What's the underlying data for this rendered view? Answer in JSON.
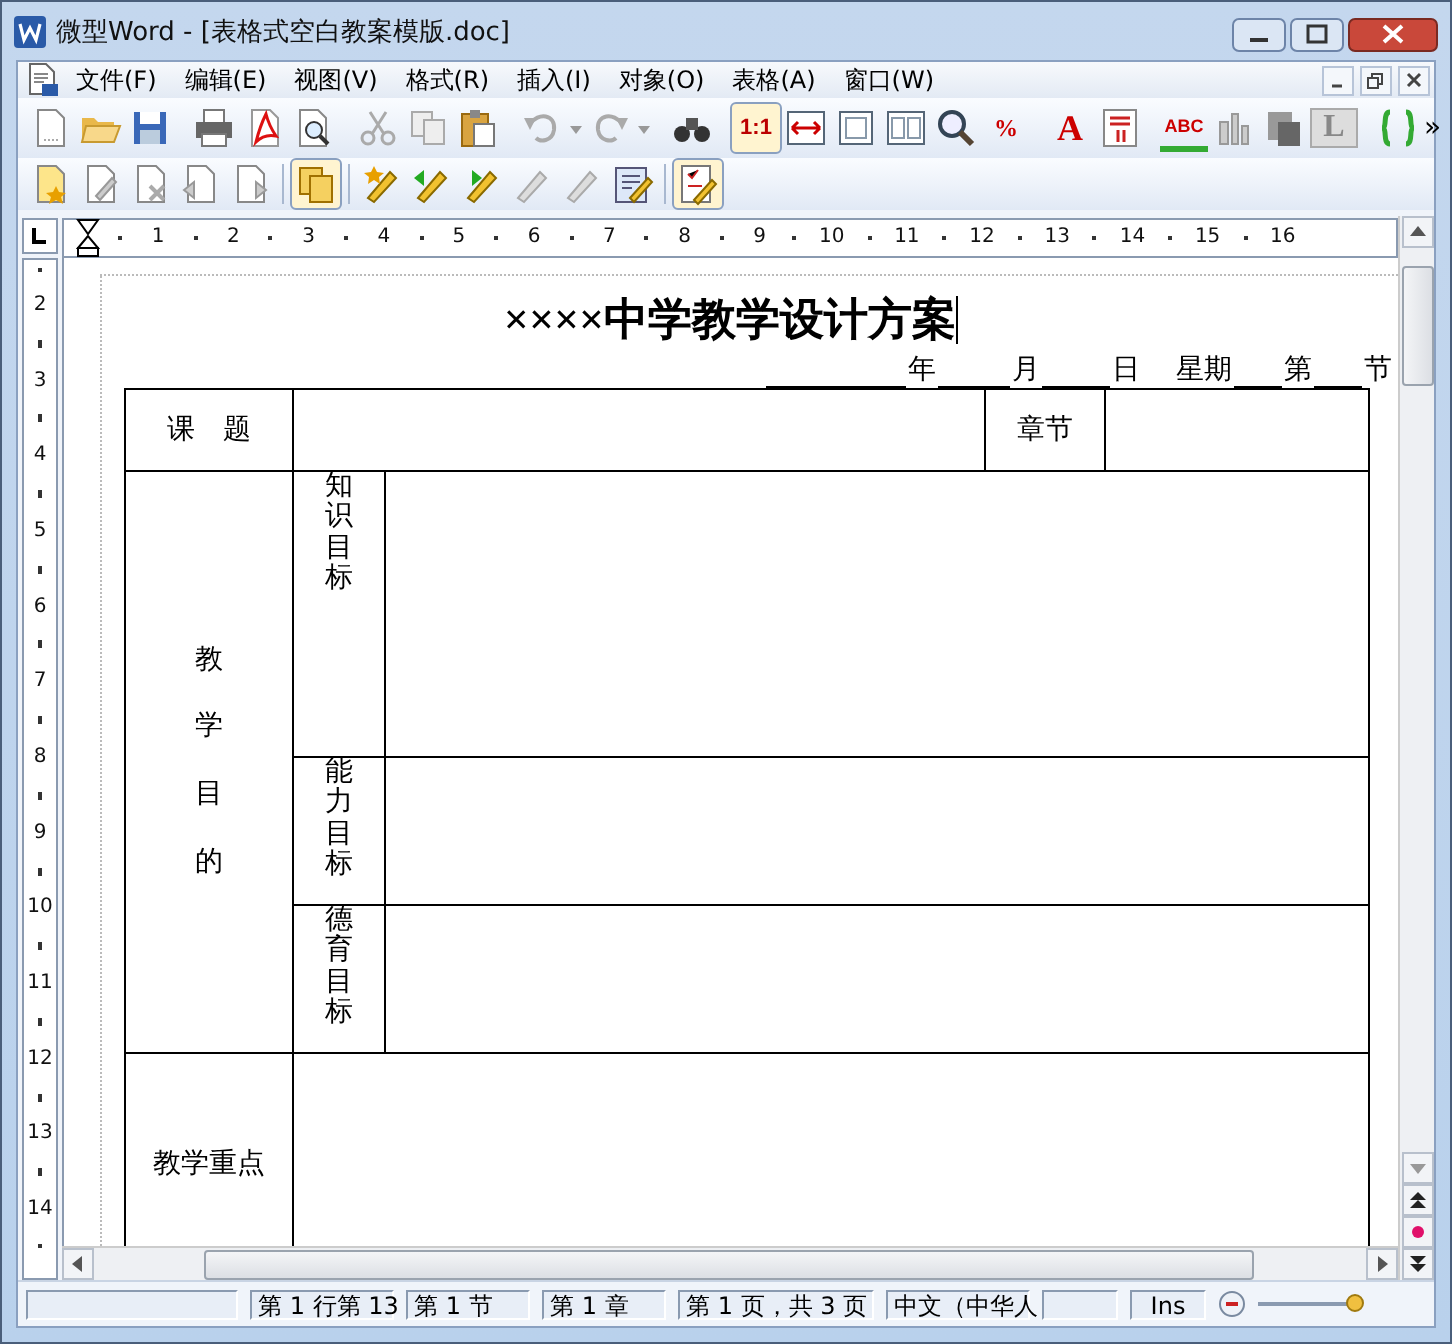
{
  "window": {
    "title": "微型Word - [表格式空白教案模版.doc]"
  },
  "menu": [
    "文件(F)",
    "编辑(E)",
    "视图(V)",
    "格式(R)",
    "插入(I)",
    "对象(O)",
    "表格(A)",
    "窗口(W)"
  ],
  "toolbar": {
    "labels": [
      "1:1",
      "%",
      "A",
      "ABC",
      "L"
    ],
    "more": "»"
  },
  "ruler": {
    "horizontal": [
      "1",
      "2",
      "3",
      "4",
      "5",
      "6",
      "7",
      "8",
      "9",
      "10",
      "11",
      "12",
      "13",
      "14",
      "15",
      "16"
    ],
    "vertical": [
      "2",
      "3",
      "4",
      "5",
      "6",
      "7",
      "8",
      "9",
      "10",
      "11",
      "12",
      "13",
      "14"
    ]
  },
  "document": {
    "title": "××××中学教学设计方案",
    "date_line": [
      "年",
      "月",
      "日",
      "星期",
      "第",
      "节"
    ],
    "table": {
      "topic": "课　题",
      "chapter": "章节",
      "purpose": "教学目的",
      "goals": [
        {
          "label": "知识目标"
        },
        {
          "label": "能力目标"
        },
        {
          "label": "德育目标"
        }
      ],
      "key_points": "教学重点"
    }
  },
  "status_bar": {
    "fields": [
      "第 1 行第 13",
      "第 1 节",
      "第 1 章",
      "第 1 页，共 3 页",
      "中文（中华人"
    ],
    "mode": "Ins",
    "zoom": {
      "level": 0.93
    }
  }
}
